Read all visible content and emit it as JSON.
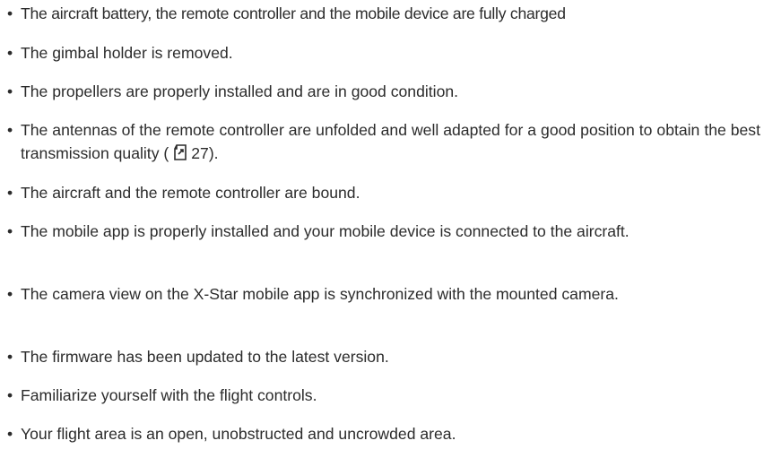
{
  "bullet_symbol": "•",
  "items": [
    {
      "text": "The aircraft battery, the remote controller and the mobile device are fully charged"
    },
    {
      "text": "The gimbal holder is removed."
    },
    {
      "text": "The propellers are properly installed and are in good condition."
    },
    {
      "text_before": "The antennas of the remote controller are unfolded and well adapted for a good position to obtain the best transmission quality (",
      "ref_icon": "page-reference-icon",
      "ref_page": "27).",
      "text": ""
    },
    {
      "text": "The aircraft and the remote controller are bound."
    },
    {
      "text": "The mobile app is properly installed and your mobile device is connected to the aircraft."
    },
    {
      "text": "The camera view on the X-Star mobile app is synchronized with the mounted camera."
    },
    {
      "text": "The firmware has been updated to the latest version."
    },
    {
      "text": "Familiarize yourself with the flight controls."
    },
    {
      "text": "Your flight area is an open, unobstructed and uncrowded area."
    }
  ]
}
